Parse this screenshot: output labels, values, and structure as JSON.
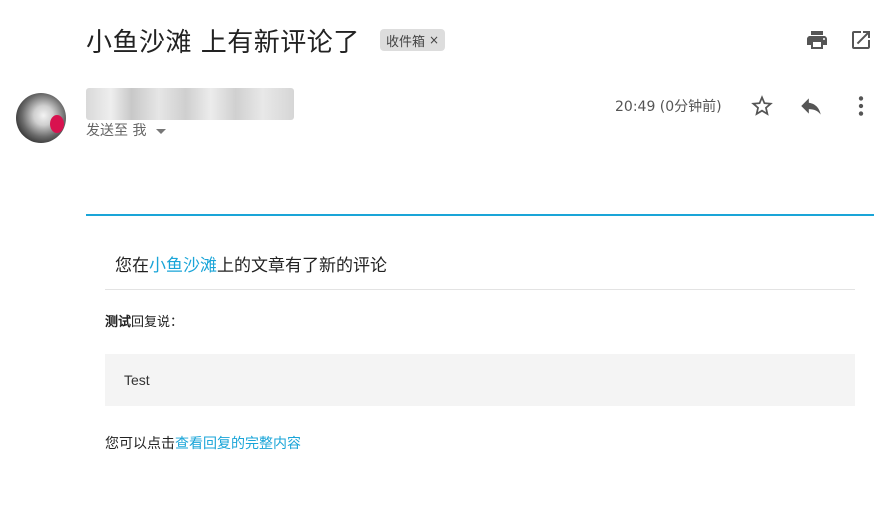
{
  "email": {
    "subject": "小鱼沙滩 上有新评论了",
    "label": "收件箱",
    "label_remove": "×",
    "to_line": "发送至 我",
    "time": "20:49 (0分钟前)"
  },
  "toolbar": {
    "print_icon": "print-icon",
    "popout_icon": "open-in-new-icon",
    "star_icon": "star-outline-icon",
    "reply_icon": "reply-icon",
    "more_icon": "more-vert-icon"
  },
  "body": {
    "headline_prefix": "您在",
    "headline_link": "小鱼沙滩",
    "headline_suffix": "上的文章有了新的评论",
    "reply_author": "测试",
    "reply_suffix": "回复说：",
    "reply_content": "Test",
    "footer_prefix": "您可以点击",
    "footer_link": "查看回复的完整内容"
  },
  "colors": {
    "accent": "#1aa5d8",
    "label_bg": "#dddddd",
    "quote_bg": "#f4f4f4"
  }
}
